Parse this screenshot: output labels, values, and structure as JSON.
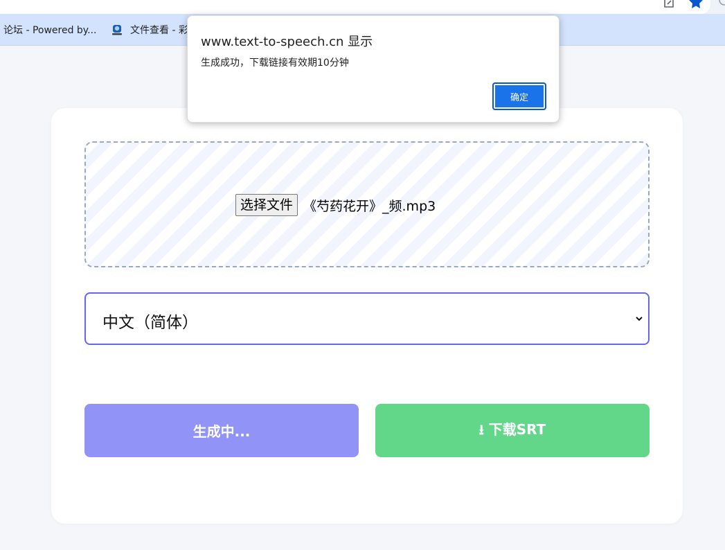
{
  "browser": {
    "toolbar_icons": [
      "share-icon",
      "bookmark-star-icon",
      "profile-icon"
    ],
    "bookmarks": [
      {
        "label": "论坛 - Powered by...",
        "icon": "none"
      },
      {
        "label": "文件查看 - 彩",
        "icon": "drive-icon"
      }
    ]
  },
  "alert": {
    "title": "www.text-to-speech.cn 显示",
    "message": "生成成功，下载链接有效期10分钟",
    "ok_label": "确定",
    "ok_color": "#1a73e8"
  },
  "uploader": {
    "choose_file_label": "选择文件",
    "file_name": "《芍药花开》_频.mp3"
  },
  "language_select": {
    "selected": "中文（简体）"
  },
  "actions": {
    "generate_label": "生成中...",
    "download_label": "⭳ 下载SRT",
    "generate_color": "#9193f6",
    "download_color": "#62d78a",
    "accent_color": "#6366f1"
  }
}
